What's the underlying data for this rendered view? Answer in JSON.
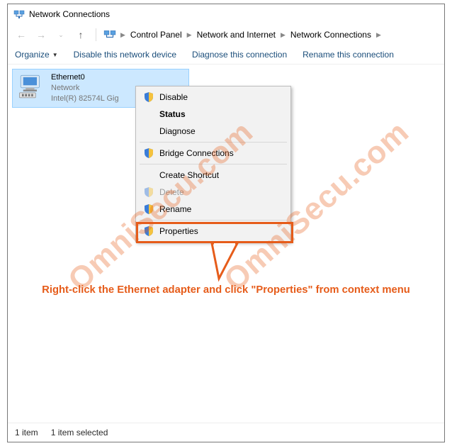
{
  "window": {
    "title": "Network Connections"
  },
  "breadcrumb": {
    "items": [
      "Control Panel",
      "Network and Internet",
      "Network Connections"
    ]
  },
  "toolbar": {
    "organize": "Organize",
    "disable_device": "Disable this network device",
    "diagnose": "Diagnose this connection",
    "rename": "Rename this connection"
  },
  "adapter": {
    "name": "Ethernet0",
    "status": "Network",
    "device": "Intel(R) 82574L Gig"
  },
  "context_menu": {
    "disable": "Disable",
    "status": "Status",
    "diagnose": "Diagnose",
    "bridge": "Bridge Connections",
    "shortcut": "Create Shortcut",
    "delete": "Delete",
    "rename": "Rename",
    "properties": "Properties"
  },
  "instruction": "Right-click the Ethernet adapter and click \"Properties\" from context menu",
  "statusbar": {
    "count": "1 item",
    "selected": "1 item selected"
  },
  "watermark": "OmniSecu.com"
}
